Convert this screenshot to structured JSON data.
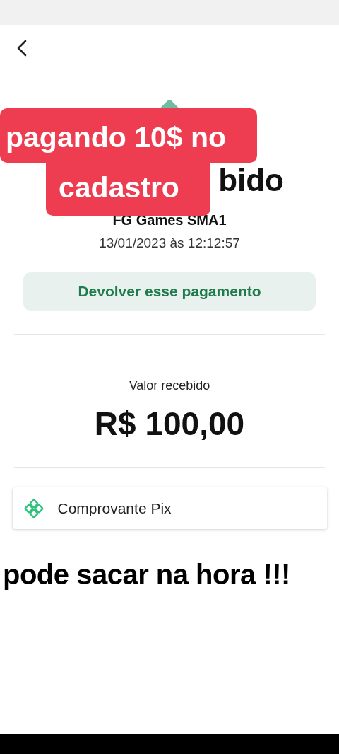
{
  "title_visible": "bido",
  "payer": "FG Games SMA1",
  "datetime": "13/01/2023 às 12:12:57",
  "refund_button": "Devolver esse pagamento",
  "amount_label": "Valor recebido",
  "amount": "R$ 100,00",
  "receipt_item": "Comprovante Pix",
  "captions": [
    {
      "kind": "boxed",
      "lines": [
        "pagando 10$ no",
        "cadastro"
      ]
    },
    {
      "kind": "plain",
      "lines": [
        "pode sacar na hora !!!"
      ]
    }
  ]
}
